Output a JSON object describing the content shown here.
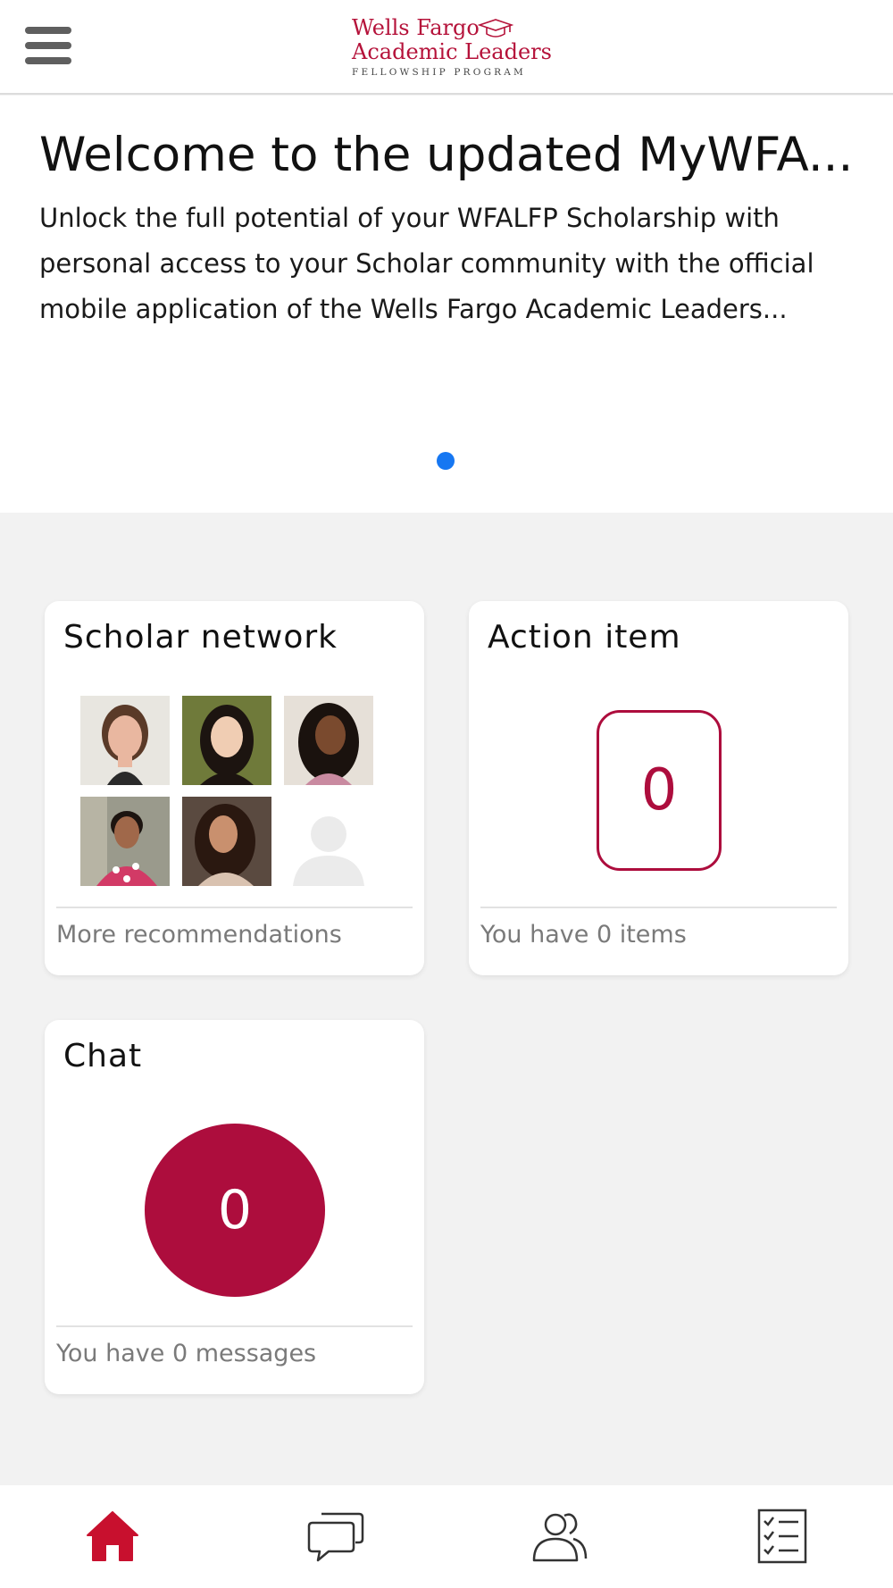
{
  "header": {
    "menu_icon": "hamburger-menu-icon",
    "logo": {
      "line1": "Wells Fargo",
      "line2": "Academic Leaders",
      "line3": "FELLOWSHIP PROGRAM",
      "icon": "graduation-cap-icon"
    }
  },
  "banner": {
    "title": "Welcome to the updated MyWFA...",
    "text": "Unlock the full potential of your WFALFP Scholarship with personal access to your Scholar community with the official mobile application of the Wells Fargo Academic Leaders...",
    "pagination": {
      "total": 1,
      "active": 1
    }
  },
  "cards": {
    "scholar_network": {
      "title": "Scholar network",
      "footer": "More recommendations",
      "avatar_count": 6
    },
    "action_item": {
      "title": "Action item",
      "count": "0",
      "footer": "You have 0 items"
    },
    "chat": {
      "title": "Chat",
      "count": "0",
      "footer": "You have 0 messages"
    }
  },
  "bottom_nav": {
    "items": [
      {
        "icon": "home-icon",
        "active": true
      },
      {
        "icon": "chat-bubbles-icon",
        "active": false
      },
      {
        "icon": "people-icon",
        "active": false
      },
      {
        "icon": "checklist-icon",
        "active": false
      }
    ]
  },
  "colors": {
    "brand": "#ad0d3d",
    "pagination_dot": "#1677f2",
    "background": "#f2f2f2"
  }
}
